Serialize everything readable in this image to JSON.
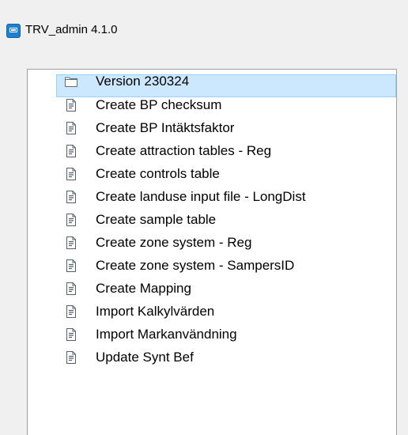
{
  "window": {
    "title": "TRV_admin 4.1.0",
    "icon": "app-window-icon",
    "accent_color": "#1f7fd0"
  },
  "tree": {
    "folder": {
      "label": "Version 230324",
      "icon": "folder-icon",
      "selected": true
    },
    "items": [
      {
        "label": "Create BP checksum",
        "icon": "script-file-icon"
      },
      {
        "label": "Create BP Intäktsfaktor",
        "icon": "script-file-icon"
      },
      {
        "label": "Create attraction tables - Reg",
        "icon": "script-file-icon"
      },
      {
        "label": "Create controls table",
        "icon": "script-file-icon"
      },
      {
        "label": "Create landuse input file - LongDist",
        "icon": "script-file-icon"
      },
      {
        "label": "Create sample table",
        "icon": "script-file-icon"
      },
      {
        "label": "Create zone system - Reg",
        "icon": "script-file-icon"
      },
      {
        "label": "Create zone system - SampersID",
        "icon": "script-file-icon"
      },
      {
        "label": "Create Mapping",
        "icon": "script-file-icon"
      },
      {
        "label": "Import Kalkylvärden",
        "icon": "script-file-icon"
      },
      {
        "label": "Import Markanvändning",
        "icon": "script-file-icon"
      },
      {
        "label": "Update Synt Bef",
        "icon": "script-file-icon"
      }
    ]
  },
  "colors": {
    "selection_fill": "#cce8ff",
    "selection_border": "#99d1ff",
    "panel_border": "#a0a0a0",
    "window_background": "#f0f0f0"
  }
}
